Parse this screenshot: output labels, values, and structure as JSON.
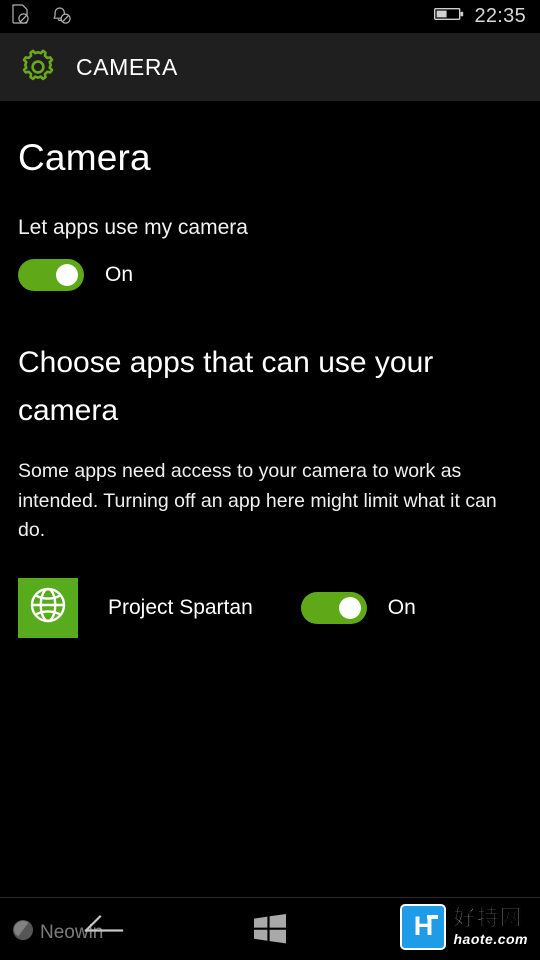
{
  "status_bar": {
    "sim_icon": "sim-card-off-icon",
    "notifications_icon": "notifications-off-icon",
    "battery_icon": "battery-icon",
    "battery_level_percent": 45,
    "time": "22:35"
  },
  "header": {
    "icon": "settings-gear-icon",
    "title": "CAMERA",
    "accent_color": "#6aaa1a",
    "background_color": "#1f1f1f"
  },
  "page": {
    "title": "Camera",
    "permission": {
      "label": "Let apps use my camera",
      "toggle_state": "On",
      "toggle_on": true
    },
    "section": {
      "title": "Choose apps that can use your camera",
      "description": "Some apps need access to your camera to work as intended. Turning off an app here might limit what it can do."
    },
    "apps": [
      {
        "name": "Project Spartan",
        "icon": "globe-icon",
        "tile_color": "#59ab1e",
        "toggle_state": "On",
        "toggle_on": true
      }
    ]
  },
  "nav_bar": {
    "back": "back-arrow-icon",
    "start": "windows-start-icon"
  },
  "watermarks": {
    "neowin": "Neowin",
    "haote_cn": "好特网",
    "haote_en": "haote.com",
    "haote_letter": "H",
    "haote_color": "#1f9ce8"
  },
  "theme": {
    "background": "#000000",
    "toggle_on_color": "#5fa818",
    "text_color": "#ffffff"
  }
}
